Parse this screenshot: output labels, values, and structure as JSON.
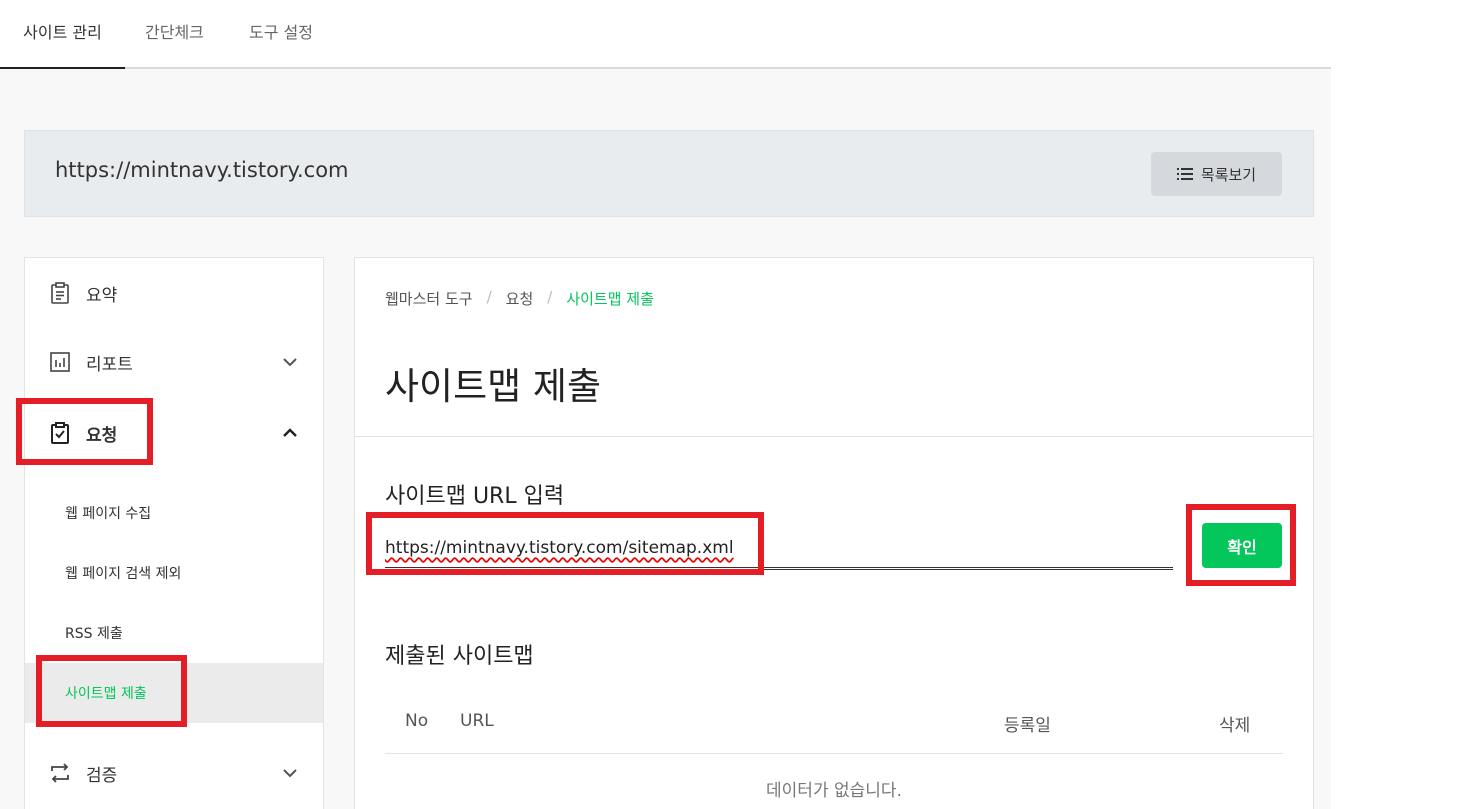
{
  "top_tabs": [
    {
      "label": "사이트 관리",
      "active": true
    },
    {
      "label": "간단체크",
      "active": false
    },
    {
      "label": "도구 설정",
      "active": false
    }
  ],
  "site_bar": {
    "url": "https://mintnavy.tistory.com",
    "list_button_label": "목록보기",
    "list_button_icon": "list-icon"
  },
  "sidebar": {
    "items": [
      {
        "label": "요약",
        "icon": "clipboard-icon"
      },
      {
        "label": "리포트",
        "icon": "bar-chart-icon",
        "chevron": "down"
      },
      {
        "label": "요청",
        "icon": "clipboard-check-icon",
        "chevron": "up",
        "expanded": true
      },
      {
        "label": "검증",
        "icon": "repeat-icon",
        "chevron": "down"
      }
    ],
    "sub_items": [
      {
        "label": "웹 페이지 수집"
      },
      {
        "label": "웹 페이지 검색 제외"
      },
      {
        "label": "RSS 제출"
      },
      {
        "label": "사이트맵 제출",
        "active": true
      }
    ]
  },
  "main": {
    "breadcrumb": [
      "웹마스터 도구",
      "요청",
      "사이트맵 제출"
    ],
    "title": "사이트맵 제출",
    "input_section_title": "사이트맵 URL 입력",
    "input_value": "https://mintnavy.tistory.com/sitemap.xml",
    "confirm_label": "확인",
    "submitted_title": "제출된 사이트맵",
    "table_headers": [
      "No",
      "URL",
      "등록일",
      "삭제"
    ],
    "empty_message": "데이터가 없습니다."
  },
  "colors": {
    "accent": "#03c75a",
    "highlight": "#e41e26"
  }
}
